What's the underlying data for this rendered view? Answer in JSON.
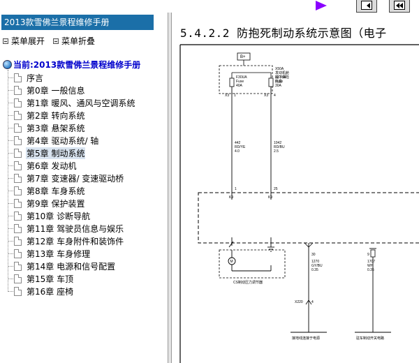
{
  "sidebar": {
    "title": "2013款雪佛兰景程维修手册",
    "menu_expand": "菜单展开",
    "menu_collapse": "菜单折叠",
    "current": "当前:2013款雪佛兰景程维修手册",
    "items": [
      {
        "label": "序言"
      },
      {
        "label": "第0章 一般信息"
      },
      {
        "label": "第1章 暖风、通风与空调系统"
      },
      {
        "label": "第2章 转向系统"
      },
      {
        "label": "第3章 悬架系统"
      },
      {
        "label": "第4章 驱动系统/ 轴"
      },
      {
        "label": "第5章 制动系统"
      },
      {
        "label": "第6章 发动机"
      },
      {
        "label": "第7章 变速器/ 变速驱动桥"
      },
      {
        "label": "第8章 车身系统"
      },
      {
        "label": "第9章 保护装置"
      },
      {
        "label": "第10章 诊断导航"
      },
      {
        "label": "第11章 驾驶员信息与娱乐"
      },
      {
        "label": "第12章 车身附件和装饰件"
      },
      {
        "label": "第13章 车身修理"
      },
      {
        "label": "第14章 电源和信号配置"
      },
      {
        "label": "第15章 车顶"
      },
      {
        "label": "第16章 座椅"
      }
    ],
    "selected_index": 6
  },
  "content": {
    "title": "5.4.2.2 防抱死制动系统示意图（电子",
    "diagram": {
      "battery_tag": "B+",
      "fuse_box_label": [
        "X50A",
        "发动机舱",
        "盖下保险",
        "丝盒"
      ],
      "fuse1": [
        "F30UA",
        "Fuse",
        "40A"
      ],
      "fuse2": [
        "F31UA",
        "Fuse",
        "30A"
      ],
      "conn_x3a": "X3",
      "conn_x3b": "X3",
      "pin_a": "1",
      "pin_b": "4",
      "wire1": [
        "442",
        "RD/YE",
        "4.0"
      ],
      "wire2": [
        "1042",
        "RD/BU",
        "2.5"
      ],
      "pin_k1": "1",
      "pin_k2": "25",
      "k_label1": "K9",
      "k_label2": "K9",
      "motor_label": "M",
      "module_label": "CS制动压力调节器",
      "pin_30": "30",
      "pin_9": "9",
      "wire3": [
        "1270",
        "GY/BU",
        "0.35"
      ],
      "wire4": [
        "1707",
        "WH",
        "0.35"
      ],
      "conn_x220": "X220",
      "conn_x220_pin": "4",
      "ground1": "接地线连接于电源",
      "ground2": "驻车制动开关电路"
    }
  },
  "toolbar": {
    "play_icon": "play-icon",
    "nav_icons": [
      "back-page-icon",
      "first-page-icon"
    ]
  }
}
